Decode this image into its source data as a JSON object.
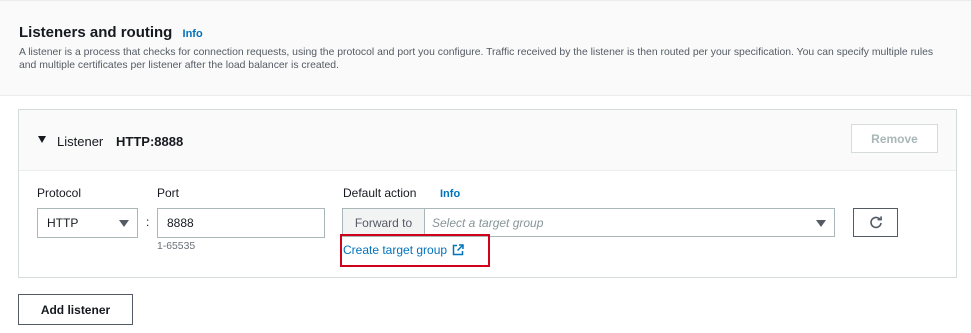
{
  "section": {
    "title": "Listeners and routing",
    "info_label": "Info",
    "description": "A listener is a process that checks for connection requests, using the protocol and port you configure. Traffic received by the listener is then routed per your specification. You can specify multiple rules and multiple certificates per listener after the load balancer is created."
  },
  "listener": {
    "label": "Listener",
    "value": "HTTP:8888",
    "remove_label": "Remove",
    "protocol": {
      "label": "Protocol",
      "value": "HTTP"
    },
    "colon": ":",
    "port": {
      "label": "Port",
      "value": "8888",
      "hint": "1-65535"
    },
    "default_action": {
      "label": "Default action",
      "info_label": "Info",
      "forward_label": "Forward to",
      "target_placeholder": "Select a target group",
      "create_target_group_label": "Create target group"
    }
  },
  "add_listener_label": "Add listener",
  "colors": {
    "link": "#0073bb",
    "highlight_border": "#d0021b",
    "header_bg": "#fafafa"
  }
}
